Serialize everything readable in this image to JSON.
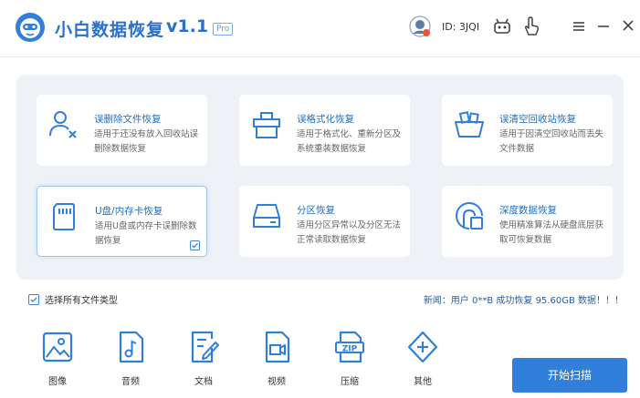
{
  "header": {
    "app_title": "小白数据恢复",
    "version": "v1.1",
    "badge": "Pro",
    "user_id": "ID: 3JQI"
  },
  "modes": [
    {
      "title": "误删除文件恢复",
      "desc": "适用于还没有放入回收站误删除数据恢复",
      "icon": "user-delete-icon",
      "selected": false
    },
    {
      "title": "误格式化恢复",
      "desc": "适用于格式化、重新分区及系统重装数据恢复",
      "icon": "format-drive-icon",
      "selected": false
    },
    {
      "title": "误清空回收站恢复",
      "desc": "适用于因清空回收站而丢失文件数据",
      "icon": "recycle-bin-icon",
      "selected": false
    },
    {
      "title": "U盘/内存卡恢复",
      "desc": "适用U盘或内存卡误删除数据恢复",
      "icon": "sd-card-icon",
      "selected": true
    },
    {
      "title": "分区恢复",
      "desc": "适用分区异常以及分区无法正常读取数据恢复",
      "icon": "hard-disk-icon",
      "selected": false
    },
    {
      "title": "深度数据恢复",
      "desc": "使用精准算法从硬盘底层获取可恢复数据",
      "icon": "deep-scan-icon",
      "selected": false
    }
  ],
  "select_all": {
    "label": "选择所有文件类型",
    "checked": true
  },
  "news": "新闻：用户 0**B 成功恢复 95.60GB 数据！！！",
  "file_types": [
    {
      "label": "图像",
      "icon": "image-icon"
    },
    {
      "label": "音频",
      "icon": "audio-icon"
    },
    {
      "label": "文档",
      "icon": "document-icon"
    },
    {
      "label": "视频",
      "icon": "video-icon"
    },
    {
      "label": "压缩",
      "icon": "zip-icon"
    },
    {
      "label": "其他",
      "icon": "other-icon"
    }
  ],
  "scan_button": "开始扫描",
  "colors": {
    "accent": "#2f7fdb",
    "title_blue": "#2b6fc8",
    "panel_bg": "#eef2f7"
  }
}
